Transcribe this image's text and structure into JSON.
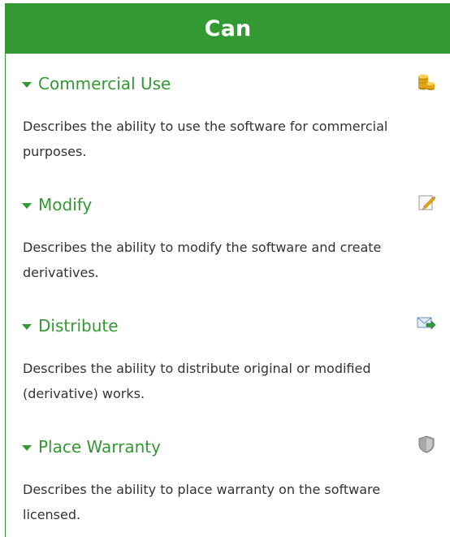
{
  "panel": {
    "title": "Can",
    "colors": {
      "accent": "#339933",
      "text": "#333333"
    },
    "items": [
      {
        "title": "Commercial Use",
        "description": "Describes the ability to use the software for commercial purposes.",
        "icon": "coins-icon"
      },
      {
        "title": "Modify",
        "description": "Describes the ability to modify the software and create derivatives.",
        "icon": "pencil-icon"
      },
      {
        "title": "Distribute",
        "description": "Describes the ability to distribute original or modified (derivative) works.",
        "icon": "mail-forward-icon"
      },
      {
        "title": "Place Warranty",
        "description": "Describes the ability to place warranty on the software licensed.",
        "icon": "shield-icon"
      }
    ]
  }
}
